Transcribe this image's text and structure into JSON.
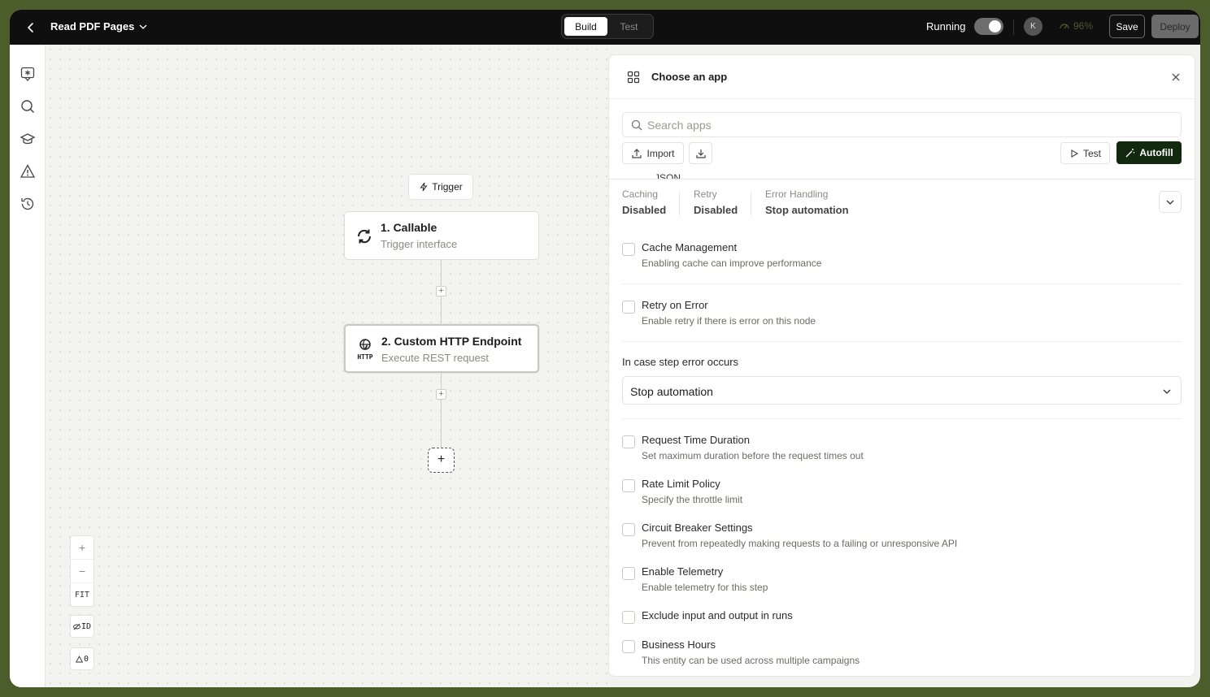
{
  "topbar": {
    "title": "Read PDF Pages",
    "tabs": [
      {
        "label": "Build",
        "active": true
      },
      {
        "label": "Test",
        "active": false
      }
    ],
    "running_label": "Running",
    "running_on": true,
    "avatar_initial": "K",
    "score": "96%",
    "save_label": "Save",
    "deploy_label": "Deploy"
  },
  "rail": {
    "icons": [
      "chat-star-icon",
      "search-icon",
      "graduation-cap-icon",
      "warning-icon",
      "history-icon"
    ]
  },
  "canvas": {
    "trigger_label": "Trigger",
    "nodes": [
      {
        "title": "1. Callable",
        "subtitle": "Trigger interface",
        "icon": "refresh-icon"
      },
      {
        "title": "2. Custom HTTP Endpoint",
        "subtitle": "Execute REST request",
        "icon": "http-globe-icon",
        "icon_text": "HTTP"
      }
    ],
    "zoom": {
      "in": "+",
      "out": "−",
      "fit": "FIT"
    },
    "id_toggle": "ID",
    "warnings_count": "0"
  },
  "panel": {
    "title": "Choose an app",
    "search_placeholder": "Search apps",
    "import_label": "Import",
    "test_label": "Test",
    "autofill_label": "Autofill",
    "peek_text": "JSON",
    "summary": [
      {
        "label": "Caching",
        "value": "Disabled"
      },
      {
        "label": "Retry",
        "value": "Disabled"
      },
      {
        "label": "Error Handling",
        "value": "Stop automation"
      }
    ],
    "options_top": [
      {
        "title": "Cache Management",
        "desc": "Enabling cache can improve performance"
      },
      {
        "title": "Retry on Error",
        "desc": "Enable retry if there is error on this node"
      }
    ],
    "error_label": "In case step error occurs",
    "error_value": "Stop automation",
    "options_bottom": [
      {
        "title": "Request Time Duration",
        "desc": "Set maximum duration before the request times out"
      },
      {
        "title": "Rate Limit Policy",
        "desc": "Specify the throttle limit"
      },
      {
        "title": "Circuit Breaker Settings",
        "desc": "Prevent from repeatedly making requests to a failing or unresponsive API"
      },
      {
        "title": "Enable Telemetry",
        "desc": "Enable telemetry for this step"
      },
      {
        "title": "Exclude input and output in runs",
        "desc": ""
      },
      {
        "title": "Business Hours",
        "desc": "This entity can be used across multiple campaigns"
      }
    ]
  }
}
